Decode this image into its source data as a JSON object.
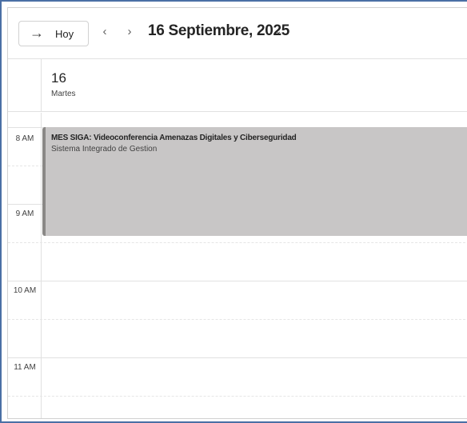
{
  "toolbar": {
    "today_label": "Hoy",
    "date_title": "16 Septiembre, 2025"
  },
  "day": {
    "number": "16",
    "weekday": "Martes"
  },
  "hours": [
    "8 AM",
    "9 AM",
    "10 AM",
    "11 AM"
  ],
  "event": {
    "title": "MES SIGA: Videoconferencia Amenazas Digitales y Ciberseguridad",
    "subtitle": "Sistema Integrado de Gestion"
  }
}
